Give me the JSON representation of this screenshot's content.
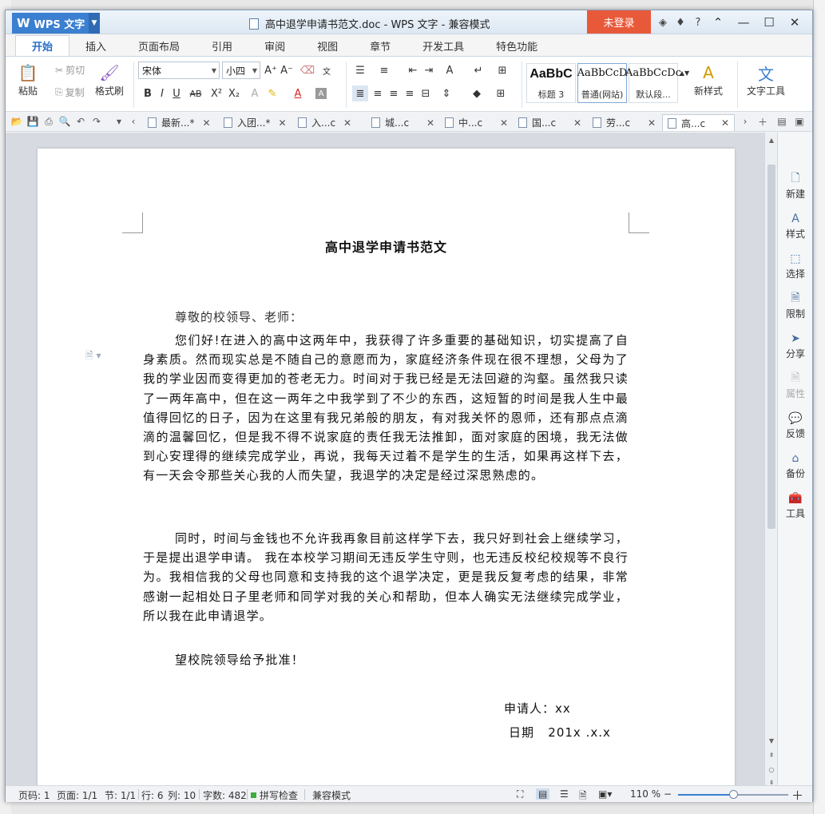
{
  "titlebar": {
    "app_name": "WPS 文字",
    "doc_title": "高中退学申请书范文.doc - WPS 文字 - 兼容模式",
    "login": "未登录"
  },
  "tabs": [
    "开始",
    "插入",
    "页面布局",
    "引用",
    "审阅",
    "视图",
    "章节",
    "开发工具",
    "特色功能"
  ],
  "ribbon": {
    "paste": "粘贴",
    "cut": "剪切",
    "copy": "复制",
    "format_painter": "格式刷",
    "font_name": "宋体",
    "font_size": "小四",
    "styles": [
      {
        "preview": "AaBbC",
        "name": "标题 3"
      },
      {
        "preview": "AaBbCcD",
        "name": "普通(网站)"
      },
      {
        "preview": "AaBbCcDc",
        "name": "默认段..."
      }
    ],
    "new_style": "新样式",
    "text_tools": "文字工具"
  },
  "doc_tabs": [
    {
      "label": "最新...",
      "modified": "*",
      "active": false
    },
    {
      "label": "入团...",
      "modified": "*",
      "active": false
    },
    {
      "label": "入...c",
      "modified": "",
      "active": false
    },
    {
      "label": "城...c",
      "modified": "",
      "active": false
    },
    {
      "label": "中...c",
      "modified": "",
      "active": false
    },
    {
      "label": "国...c",
      "modified": "",
      "active": false
    },
    {
      "label": "劳...c",
      "modified": "",
      "active": false
    },
    {
      "label": "高...c",
      "modified": "",
      "active": true
    }
  ],
  "document": {
    "title": "高中退学申请书范文",
    "salutation": "尊敬的校领导、老师：",
    "paragraphs": [
      "您们好!在进入的高中这两年中，我获得了许多重要的基础知识，切实提高了自身素质。然而现实总是不随自己的意愿而为，家庭经济条件现在很不理想，父母为了我的学业因而变得更加的苍老无力。时间对于我已经是无法回避的沟壑。虽然我只读了一两年高中，但在这一两年之中我学到了不少的东西，这短暂的时间是我人生中最值得回忆的日子，因为在这里有我兄弟般的朋友，有对我关怀的恩师，还有那点点滴滴的温馨回忆，但是我不得不说家庭的责任我无法推卸，面对家庭的困境，我无法做到心安理得的继续完成学业，再说，我每天过着不是学生的生活，如果再这样下去，有一天会令那些关心我的人而失望，我退学的决定是经过深思熟虑的。",
      "同时，时间与金钱也不允许我再象目前这样学下去，我只好到社会上继续学习，于是提出退学申请。 我在本校学习期间无违反学生守则，也无违反校纪校规等不良行为。我相信我的父母也同意和支持我的这个退学决定，更是我反复考虑的结果，非常感谢一起相处日子里老师和同学对我的关心和帮助，但本人确实无法继续完成学业，所以我在此申请退学。",
      "望校院领导给予批准！"
    ],
    "applicant": "申请人：xx",
    "date": "日期   201x .x.x"
  },
  "side_panel": [
    {
      "label": "新建",
      "icon": "new-doc-icon",
      "disabled": false
    },
    {
      "label": "样式",
      "icon": "style-icon",
      "disabled": false
    },
    {
      "label": "选择",
      "icon": "select-icon",
      "disabled": false
    },
    {
      "label": "限制",
      "icon": "restrict-icon",
      "disabled": false
    },
    {
      "label": "分享",
      "icon": "share-icon",
      "disabled": false
    },
    {
      "label": "属性",
      "icon": "properties-icon",
      "disabled": true
    },
    {
      "label": "反馈",
      "icon": "feedback-icon",
      "disabled": false
    },
    {
      "label": "备份",
      "icon": "backup-icon",
      "disabled": false
    },
    {
      "label": "工具",
      "icon": "toolbox-icon",
      "disabled": false
    }
  ],
  "status": {
    "page_num": "页码: 1",
    "pages": "页面: 1/1",
    "section": "节: 1/1",
    "row": "行: 6",
    "col": "列: 10",
    "words": "字数: 482",
    "spellcheck": "拼写检查",
    "compat": "兼容模式",
    "zoom": "110 %",
    "zoom_fraction": 0.5
  },
  "colors": {
    "accent": "#3b7fd0",
    "login": "#e8593a"
  }
}
